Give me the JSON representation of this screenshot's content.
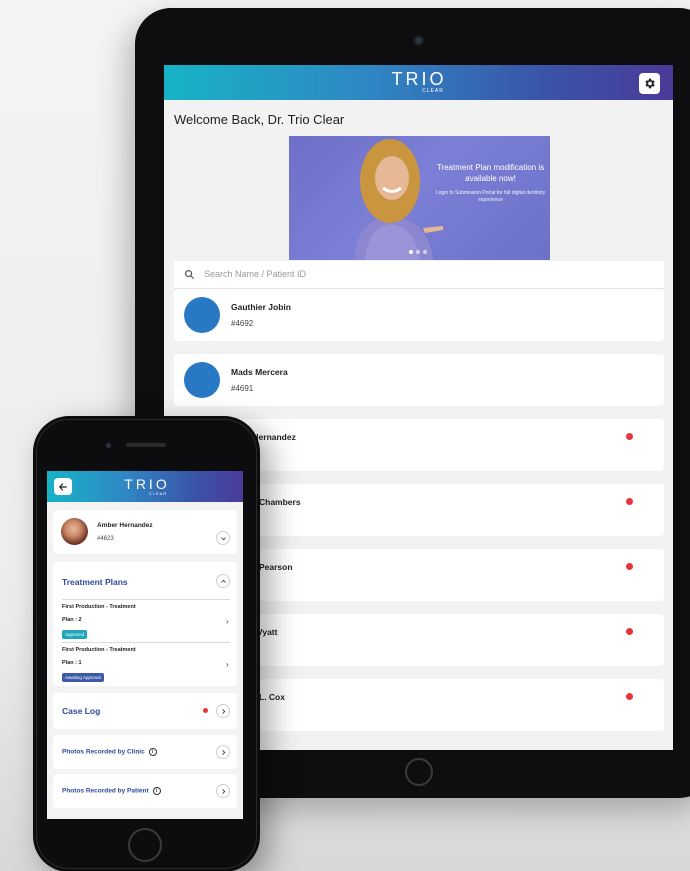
{
  "tablet": {
    "logo_word": "TRIO",
    "logo_sub": "CLEAR",
    "welcome": "Welcome Back, Dr. Trio Clear",
    "banner": {
      "title": "Treatment Plan modification is available now!",
      "subtitle": "Login to Submission Portal for full digital dentistry experience"
    },
    "search_placeholder": "Search Name / Patient ID",
    "patients": [
      {
        "name": "Gauthier Jobin",
        "id": "#4692",
        "has_alert": false
      },
      {
        "name": "Mads Mercera",
        "id": "#4691",
        "has_alert": false
      },
      {
        "name": "er Hernandez",
        "id": "",
        "has_alert": true
      },
      {
        "name": "Chambers",
        "id": "",
        "has_alert": true
      },
      {
        "name": "Pearson",
        "id": "",
        "has_alert": true
      },
      {
        "name": "Vyatt",
        "id": "",
        "has_alert": true
      },
      {
        "name": "L. Cox",
        "id": "",
        "has_alert": true
      }
    ],
    "colors": {
      "avatar": "#2978c4",
      "alert": "#e8333a"
    }
  },
  "phone": {
    "logo_word": "TRIO",
    "logo_sub": "CLEAR",
    "patient": {
      "name": "Amber Hernandez",
      "id": "#4623"
    },
    "treatment_plans": {
      "title": "Treatment Plans",
      "items": [
        {
          "name": "First Production - Treatment",
          "plan": "Plan : 2",
          "status": "Approved"
        },
        {
          "name": "First Production - Treatment",
          "plan": "Plan : 1",
          "status": "Awaiting Approval"
        }
      ]
    },
    "case_log": {
      "title": "Case Log"
    },
    "photos_clinic": {
      "title": "Photos Recorded by Clinic"
    },
    "photos_patient": {
      "title": "Photos Recorded by Patient"
    },
    "colors": {
      "approved": "#1fa6bd",
      "awaiting": "#3d5aa8",
      "section_title": "#2e4a9a"
    }
  }
}
